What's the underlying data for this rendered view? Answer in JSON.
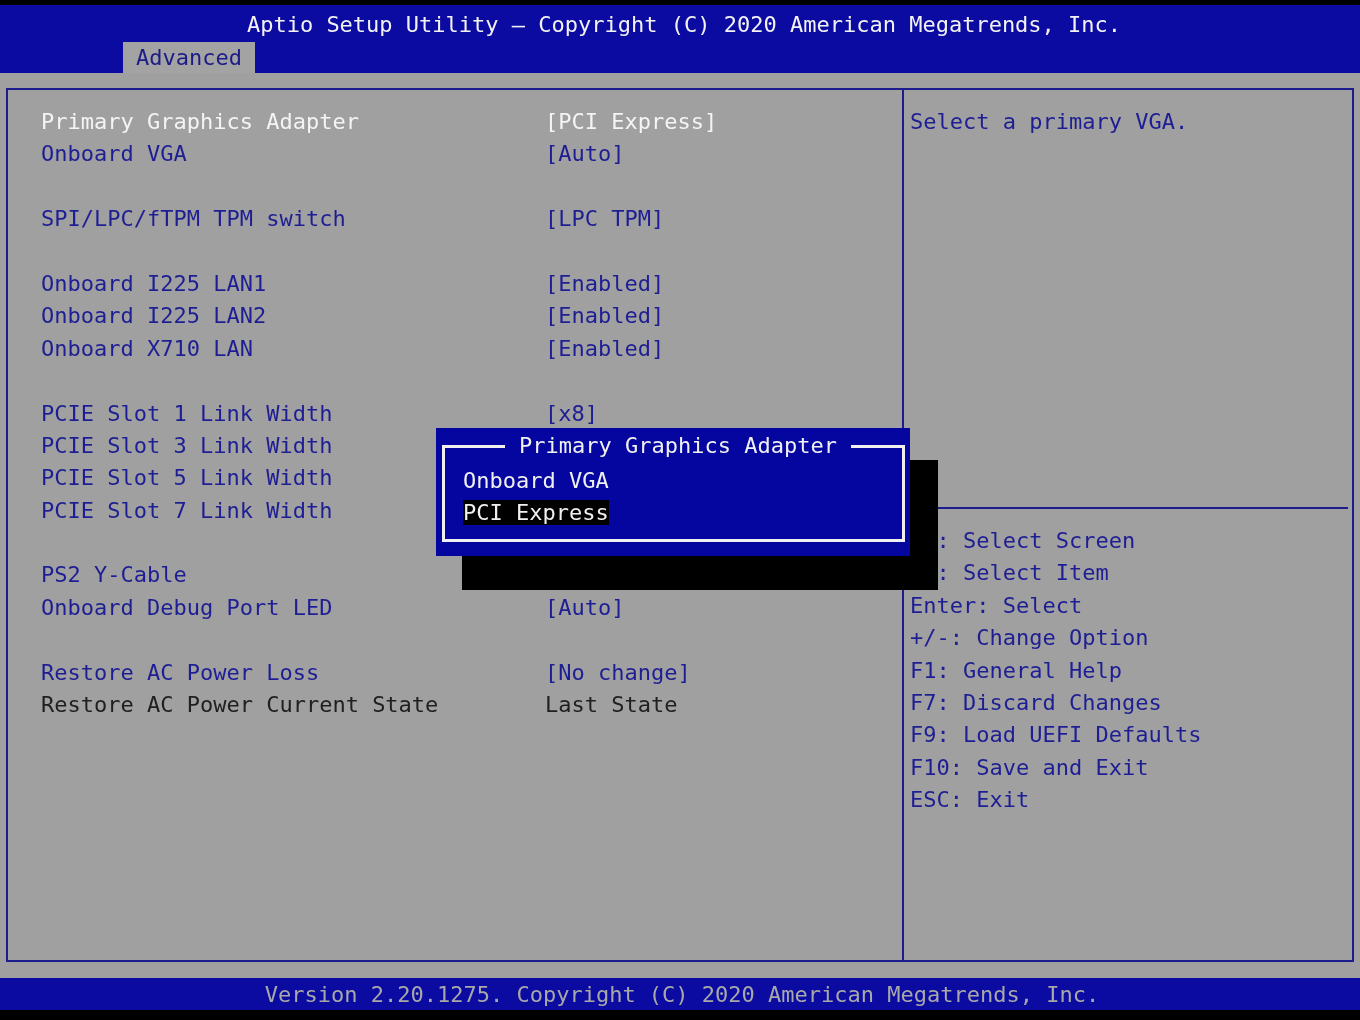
{
  "window": {
    "title": "Aptio Setup Utility – Copyright (C) 2020 American Megatrends, Inc."
  },
  "tabs": [
    {
      "label": "Advanced",
      "selected": true
    }
  ],
  "settings": {
    "groups": [
      [
        {
          "label": "Primary Graphics Adapter",
          "value": "[PCI Express]",
          "kind": "option",
          "selected": true
        },
        {
          "label": "Onboard VGA",
          "value": "[Auto]",
          "kind": "option",
          "selected": false
        }
      ],
      [
        {
          "label": "SPI/LPC/fTPM TPM switch",
          "value": "[LPC TPM]",
          "kind": "option",
          "selected": false
        }
      ],
      [
        {
          "label": "Onboard I225 LAN1",
          "value": "[Enabled]",
          "kind": "option",
          "selected": false
        },
        {
          "label": "Onboard I225 LAN2",
          "value": "[Enabled]",
          "kind": "option",
          "selected": false
        },
        {
          "label": "Onboard X710 LAN",
          "value": "[Enabled]",
          "kind": "option",
          "selected": false
        }
      ],
      [
        {
          "label": "PCIE Slot 1 Link Width",
          "value": "[x8]",
          "kind": "option",
          "selected": false
        },
        {
          "label": "PCIE Slot 3 Link Width",
          "kind": "option",
          "selected": false
        },
        {
          "label": "PCIE Slot 5 Link Width",
          "kind": "option",
          "selected": false
        },
        {
          "label": "PCIE Slot 7 Link Width",
          "kind": "option",
          "selected": false
        }
      ],
      [
        {
          "label": "PS2 Y-Cable",
          "kind": "option",
          "selected": false
        },
        {
          "label": "Onboard Debug Port LED",
          "value": "[Auto]",
          "kind": "option",
          "selected": false
        }
      ],
      [
        {
          "label": "Restore AC Power Loss",
          "value": "[No change]",
          "kind": "option",
          "selected": false
        },
        {
          "label": "Restore AC Power Current State",
          "value": "Last State",
          "kind": "info",
          "selected": false
        }
      ]
    ]
  },
  "help": {
    "text": "Select a primary VGA.",
    "keys": [
      {
        "text": ": Select Screen",
        "kind": "partial"
      },
      {
        "text": ": Select Item",
        "kind": "partial"
      },
      {
        "text": "Enter: Select",
        "kind": "full"
      },
      {
        "text": "+/-: Change Option",
        "kind": "full"
      },
      {
        "text": "F1: General Help",
        "kind": "full"
      },
      {
        "text": "F7: Discard Changes",
        "kind": "full"
      },
      {
        "text": "F9: Load UEFI Defaults",
        "kind": "full"
      },
      {
        "text": "F10: Save and Exit",
        "kind": "full"
      },
      {
        "text": "ESC: Exit",
        "kind": "full"
      }
    ]
  },
  "popup": {
    "title": "Primary Graphics Adapter",
    "options": [
      {
        "label": "Onboard VGA",
        "selected": false
      },
      {
        "label": "PCI Express",
        "selected": true
      }
    ]
  },
  "status_bar": {
    "text": "Version 2.20.1275. Copyright (C) 2020 American Megatrends, Inc."
  }
}
